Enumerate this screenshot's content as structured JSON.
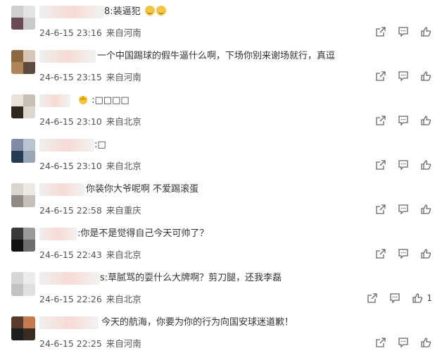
{
  "comments": [
    {
      "text": "8:装逼犯",
      "time": "24-6-15 23:16",
      "location": "来自河南",
      "likes": ""
    },
    {
      "text": "一个中国踢球的假牛逼什么啊，下场你别来谢场就行，真逗",
      "time": "24-6-15 23:15",
      "location": "来自河南",
      "likes": ""
    },
    {
      "text": ":□□□□",
      "time": "24-6-15 23:10",
      "location": "来自北京",
      "likes": ""
    },
    {
      "text": ":□",
      "time": "24-6-15 23:10",
      "location": "来自北京",
      "likes": ""
    },
    {
      "text": "你装你大爷呢啊 不爱踢滚蛋",
      "time": "24-6-15 22:58",
      "location": "来自重庆",
      "likes": ""
    },
    {
      "text": ":你是不是觉得自己今天可帅了？",
      "time": "24-6-15 22:43",
      "location": "来自北京",
      "likes": ""
    },
    {
      "text": "s:草腻骂的耍什么大牌啊？剪刀腿，还我李磊",
      "time": "24-6-15 22:26",
      "location": "来自北京",
      "likes": "1"
    },
    {
      "text": "今天的航海，你要为你的行为向国安球迷道歉！",
      "time": "24-6-15 22:25",
      "location": "来自河南",
      "likes": ""
    }
  ],
  "icons": {
    "share": "share-icon",
    "comment": "comment-icon",
    "like": "thumbs-up-icon"
  },
  "colors": {
    "text": "#333333",
    "meta": "#555555",
    "icon": "#666666"
  }
}
